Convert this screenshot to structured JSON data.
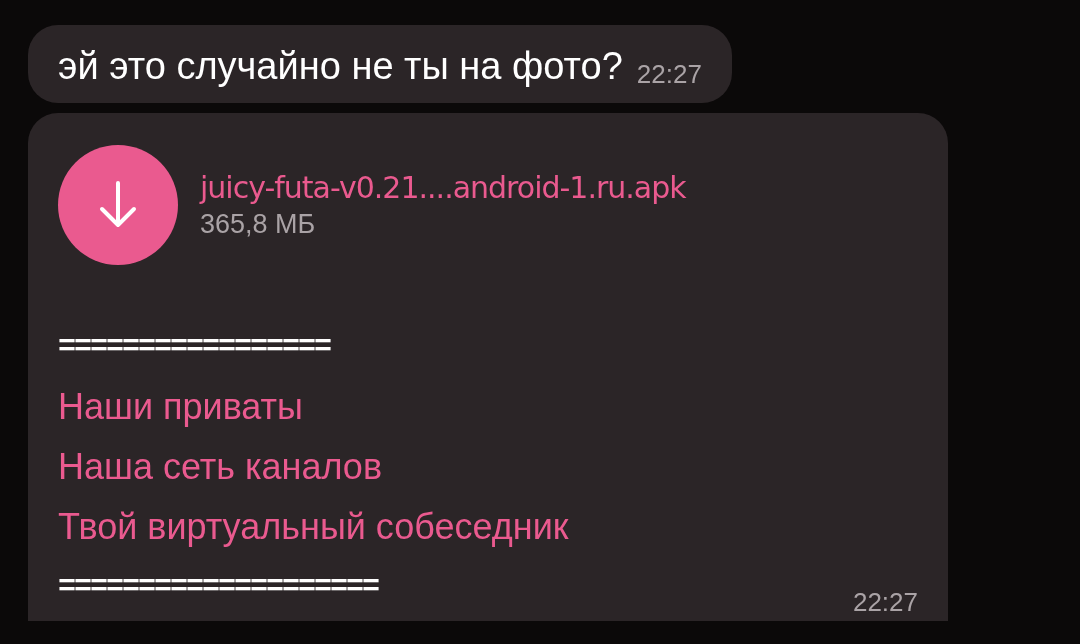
{
  "messages": [
    {
      "kind": "text",
      "text": "эй это случайно не ты на фото?",
      "time": "22:27"
    },
    {
      "kind": "file",
      "file": {
        "name": "juicy-futa-v0.21....android-1.ru.apk",
        "size": "365,8 МБ"
      },
      "lines": [
        {
          "kind": "separator",
          "text": "================="
        },
        {
          "kind": "link",
          "text": "Наши приваты"
        },
        {
          "kind": "link",
          "text": "Наша сеть каналов"
        },
        {
          "kind": "link",
          "text": "Твой виртуальный собеседник"
        },
        {
          "kind": "separator",
          "text": "===================="
        }
      ],
      "time": "22:27"
    }
  ]
}
